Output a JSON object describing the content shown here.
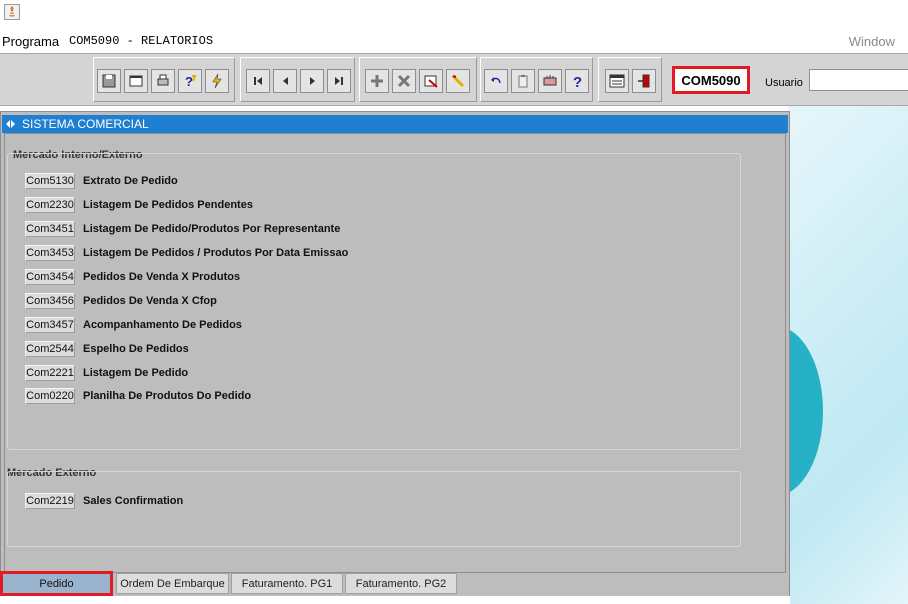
{
  "menubar": {
    "programa": "Programa",
    "form_title": "COM5090 - RELATORIOS",
    "window": "Window"
  },
  "toolbar": {
    "form_code": "COM5090",
    "user_label": "Usuario",
    "user_value": "",
    "buttons": [
      "save-icon",
      "window-icon",
      "print-icon",
      "query-help-icon",
      "query-run-icon",
      "first-record-icon",
      "previous-record-icon",
      "next-record-icon",
      "last-record-icon",
      "insert-record-icon",
      "delete-record-icon",
      "clear-record-icon",
      "edit-icon",
      "undo-icon",
      "clipboard-icon",
      "hand-icon",
      "help-icon",
      "menu-icon",
      "exit-icon"
    ]
  },
  "window": {
    "title": "SISTEMA COMERCIAL",
    "group1": {
      "label": "Mercado Interno/Externo",
      "items": [
        {
          "code": "Com5130",
          "label": "Extrato De Pedido"
        },
        {
          "code": "Com2230",
          "label": "Listagem De Pedidos Pendentes"
        },
        {
          "code": "Com3451",
          "label": "Listagem De Pedido/Produtos Por Representante"
        },
        {
          "code": "Com3453",
          "label": "Listagem De Pedidos / Produtos Por Data Emissao"
        },
        {
          "code": "Com3454",
          "label": "Pedidos De Venda X Produtos"
        },
        {
          "code": "Com3456",
          "label": "Pedidos De Venda X Cfop"
        },
        {
          "code": "Com3457",
          "label": "Acompanhamento De Pedidos"
        },
        {
          "code": "Com2544",
          "label": "Espelho De Pedidos"
        },
        {
          "code": "Com2221",
          "label": "Listagem De Pedido"
        },
        {
          "code": "Com0220",
          "label": "Planilha De Produtos Do Pedido"
        }
      ]
    },
    "group2": {
      "label": "Mercado Externo",
      "items": [
        {
          "code": "Com2219",
          "label": "Sales Confirmation"
        }
      ]
    }
  },
  "tabs": [
    "Pedido",
    "Ordem De Embarque",
    "Faturamento. PG1",
    "Faturamento. PG2"
  ],
  "colors": {
    "accent": "#1f7fd0",
    "highlight": "#e01b24",
    "active_tab": "#9bb4ce"
  }
}
